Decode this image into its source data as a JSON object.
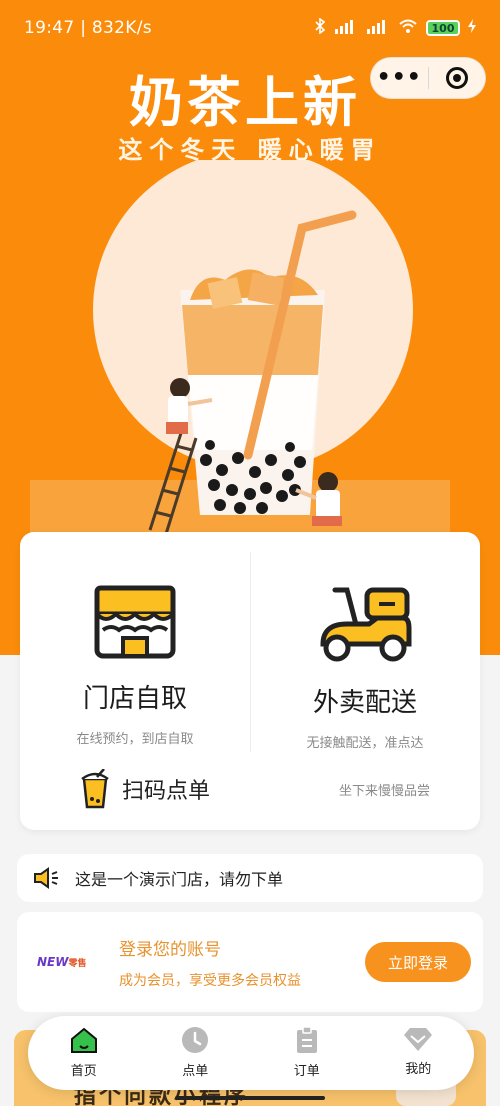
{
  "status_bar": {
    "time_speed": "19:47 | 832K/s",
    "bluetooth_icon": "bluetooth-icon",
    "signal1": "HD",
    "signal2": "HD",
    "wifi_icon": "wifi-icon",
    "battery_level": "100",
    "charging_icon": "charging-icon"
  },
  "capsule": {
    "more_icon": "more-dots-icon",
    "more_text": "•••",
    "close_icon": "target-icon"
  },
  "hero": {
    "headline": "奶茶上新",
    "subline": "这个冬天  暖心暖胃",
    "colors": {
      "background": "#fb8c0b",
      "circle": "#fde9d5",
      "tea": "#f3a54a"
    }
  },
  "services": [
    {
      "title": "门店自取",
      "subtitle": "在线预约，到店自取",
      "icon": "store-icon"
    },
    {
      "title": "外卖配送",
      "subtitle": "无接触配送，准点达",
      "icon": "scooter-icon"
    }
  ],
  "scan": {
    "label": "扫码点单",
    "subtitle": "坐下来慢慢品尝",
    "icon": "milk-tea-cup-icon"
  },
  "notice": {
    "text": "这是一个演示门店，请勿下单",
    "icon": "speaker-icon"
  },
  "login": {
    "logo_text": "NEW",
    "logo_tail": "零售",
    "title": "登录您的账号",
    "subtitle": "成为会员，享受更多会员权益",
    "button": "立即登录",
    "accent": "#f7921f"
  },
  "promo": {
    "text": "指个向款小程序"
  },
  "tabbar": [
    {
      "label": "首页",
      "icon": "home-icon",
      "active": true
    },
    {
      "label": "点单",
      "icon": "clock-icon",
      "active": false
    },
    {
      "label": "订单",
      "icon": "clipboard-icon",
      "active": false
    },
    {
      "label": "我的",
      "icon": "diamond-icon",
      "active": false
    }
  ]
}
